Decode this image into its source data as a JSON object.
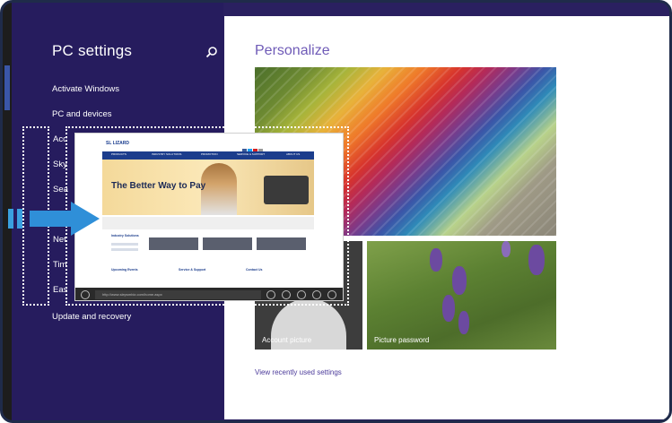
{
  "settings": {
    "title": "PC settings",
    "nav_items": [
      "Activate Windows",
      "PC and devices"
    ],
    "nav_partial": [
      "Acc",
      "Sky",
      "Sea",
      "Net",
      "Tim",
      "Eas"
    ],
    "last_item": "Update and recovery"
  },
  "personalize": {
    "title": "Personalize",
    "account_picture_label": "Account picture",
    "picture_password_label": "Picture password",
    "recent_link": "View recently used settings"
  },
  "browser": {
    "logo_text": "SL LIZARD",
    "hero_text": "The Better Way to Pay",
    "url_text": "http://www.slepsmbiz.com/home.aspx",
    "menu_items": [
      "PRODUCTS",
      "INDUSTRY SOLUTIONS",
      "PROMOTION",
      "SERVICE & SUPPORT",
      "ABOUT US"
    ],
    "section_titles": [
      "Industry Solutions",
      "Upcoming Events",
      "Service & Support",
      "Contact Us"
    ]
  },
  "colors": {
    "settings_bg": "#261c5e",
    "accent": "#6f5bb7",
    "snap_arrow": "#2f8fd8"
  },
  "icons": [
    "search-icon",
    "snap-arrow-icon",
    "back-icon",
    "refresh-icon",
    "pin-icon",
    "tools-icon",
    "forward-icon"
  ]
}
